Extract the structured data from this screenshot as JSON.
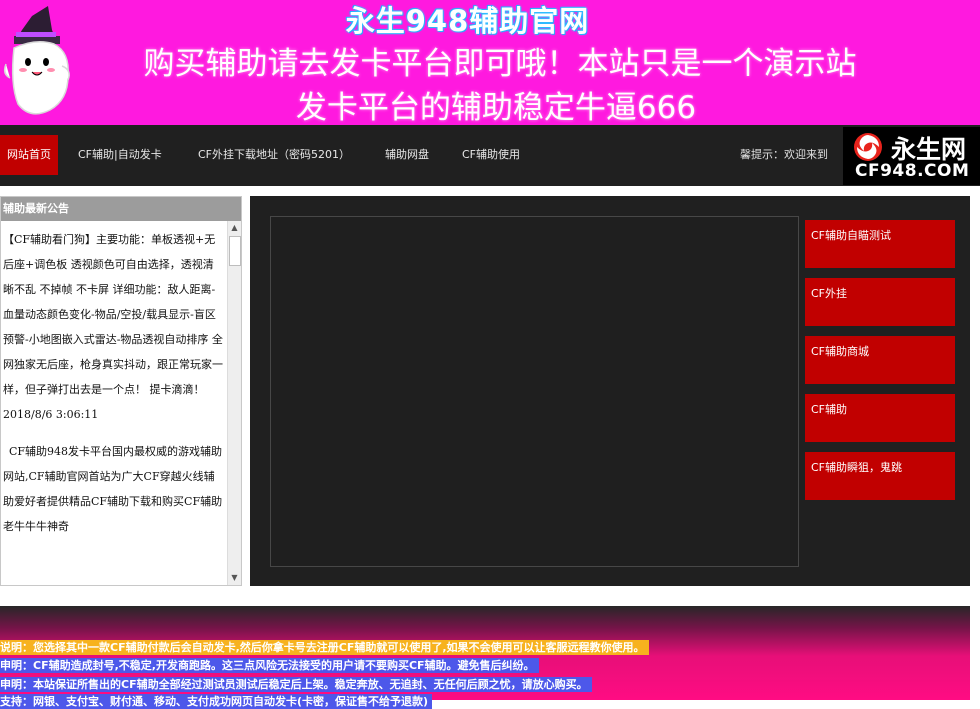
{
  "banner": {
    "title": "永生948辅助官网",
    "line1": "购买辅助请去发卡平台即可哦！本站只是一个演示站",
    "line2": "发卡平台的辅助稳定牛逼666"
  },
  "nav": {
    "items": [
      {
        "label": "网站首页"
      },
      {
        "label": "CF辅助|自动发卡"
      },
      {
        "label": "CF外挂下载地址（密码5201）"
      },
      {
        "label": "辅助网盘"
      },
      {
        "label": "CF辅助使用"
      }
    ],
    "tip": "馨提示：欢迎来到"
  },
  "logo": {
    "cn": "永生网",
    "en": "CF948.COM"
  },
  "notice": {
    "header": "辅助最新公告",
    "paragraph1": "【CF辅助看门狗】主要功能：单板透视+无后座+调色板 透视颜色可自由选择，透视清晰不乱 不掉帧 不卡屏 详细功能：敌人距离-血量动态颜色变化-物品/空投/载具显示-盲区预警-小地图嵌入式雷达-物品透视自动排序 全网独家无后座，枪身真实抖动，跟正常玩家一样，但子弹打出去是一个点！ 提卡滴滴！",
    "date": "2018/8/6 3:06:11",
    "paragraph2": "CF辅助948发卡平台国内最权威的游戏辅助网站,CF辅助官网首站为广大CF穿越火线辅助爱好者提供精品CF辅助下载和购买CF辅助老牛牛牛神奇"
  },
  "side_buttons": [
    "CF辅助自瞄测试",
    "CF外挂",
    "CF辅助商城",
    "CF辅助",
    "CF辅助瞬狙，鬼跳"
  ],
  "disclaimers": [
    "说明：您选择其中一款CF辅助付款后会自动发卡,然后你拿卡号去注册CF辅助就可以使用了,如果不会使用可以让客服远程教你使用。",
    "申明：CF辅助造成封号,不稳定,开发商跑路。这三点风险无法接受的用户请不要购买CF辅助。避免售后纠纷。",
    "申明：本站保证所售出的CF辅助全部经过测试员测试后稳定后上架。稳定奔放、无追封、无任何后顾之忧，请放心购买。",
    "支持：网银、支付宝、财付通、移动、支付成功网页自动发卡(卡密，保证售不给予退款)"
  ],
  "colors": {
    "banner_bg": "#ff19df",
    "nav_bg": "#202020",
    "accent_red": "#c10000",
    "notice_header": "#9c9c9c"
  }
}
